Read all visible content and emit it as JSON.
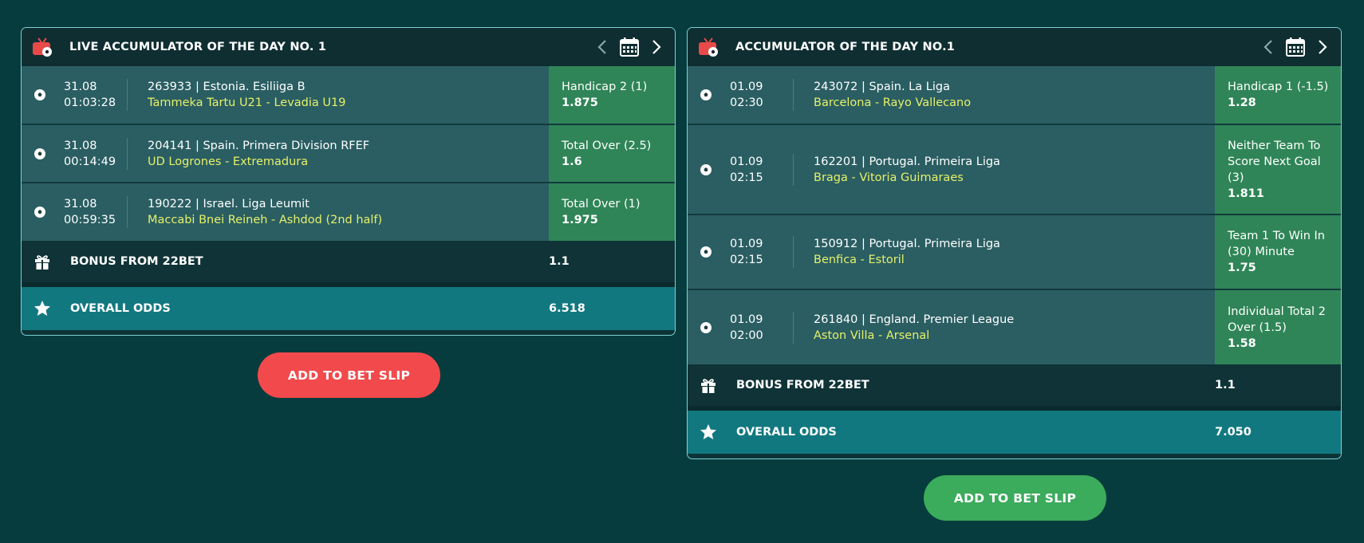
{
  "colors": {
    "background": "#063c3d",
    "header": "#0f2e31",
    "row": "#2a5e62",
    "bet_cell": "#2f8557",
    "teams_text": "#e6f06a",
    "overall_row": "#127880",
    "add_live": "#f24a4c",
    "add_day": "#3bab5c"
  },
  "live": {
    "title": "LIVE ACCUMULATOR OF THE DAY NO. 1",
    "events": [
      {
        "date": "31.08",
        "time": "01:03:28",
        "league": "263933 | Estonia. Esiliiga B",
        "teams": "Tammeka Tartu U21 - Levadia U19",
        "bet": "Handicap 2 (1)",
        "odds": "1.875"
      },
      {
        "date": "31.08",
        "time": "00:14:49",
        "league": "204141 | Spain. Primera Division RFEF",
        "teams": "UD Logrones - Extremadura",
        "bet": "Total Over (2.5)",
        "odds": "1.6"
      },
      {
        "date": "31.08",
        "time": "00:59:35",
        "league": "190222 | Israel. Liga Leumit",
        "teams": "Maccabi Bnei Reineh - Ashdod (2nd half)",
        "bet": "Total Over (1)",
        "odds": "1.975"
      }
    ],
    "bonus_label": "BONUS FROM 22BET",
    "bonus_value": "1.1",
    "overall_label": "OVERALL ODDS",
    "overall_value": "6.518",
    "add_label": "ADD TO BET SLIP"
  },
  "day": {
    "title": "ACCUMULATOR OF THE DAY NO.1",
    "events": [
      {
        "date": "01.09",
        "time": "02:30",
        "league": "243072 | Spain. La Liga",
        "teams": "Barcelona - Rayo Vallecano",
        "bet": "Handicap 1 (-1.5)",
        "odds": "1.28"
      },
      {
        "date": "01.09",
        "time": "02:15",
        "league": "162201 | Portugal. Primeira Liga",
        "teams": "Braga - Vitoria Guimaraes",
        "bet": "Neither Team To Score Next Goal (3)",
        "odds": "1.811"
      },
      {
        "date": "01.09",
        "time": "02:15",
        "league": "150912 | Portugal. Primeira Liga",
        "teams": "Benfica - Estoril",
        "bet": "Team 1 To Win In (30) Minute",
        "odds": "1.75"
      },
      {
        "date": "01.09",
        "time": "02:00",
        "league": "261840 | England. Premier League",
        "teams": "Aston Villa - Arsenal",
        "bet": "Individual Total 2 Over (1.5)",
        "odds": "1.58"
      }
    ],
    "bonus_label": "BONUS FROM 22BET",
    "bonus_value": "1.1",
    "overall_label": "OVERALL ODDS",
    "overall_value": "7.050",
    "add_label": "ADD TO BET SLIP"
  }
}
